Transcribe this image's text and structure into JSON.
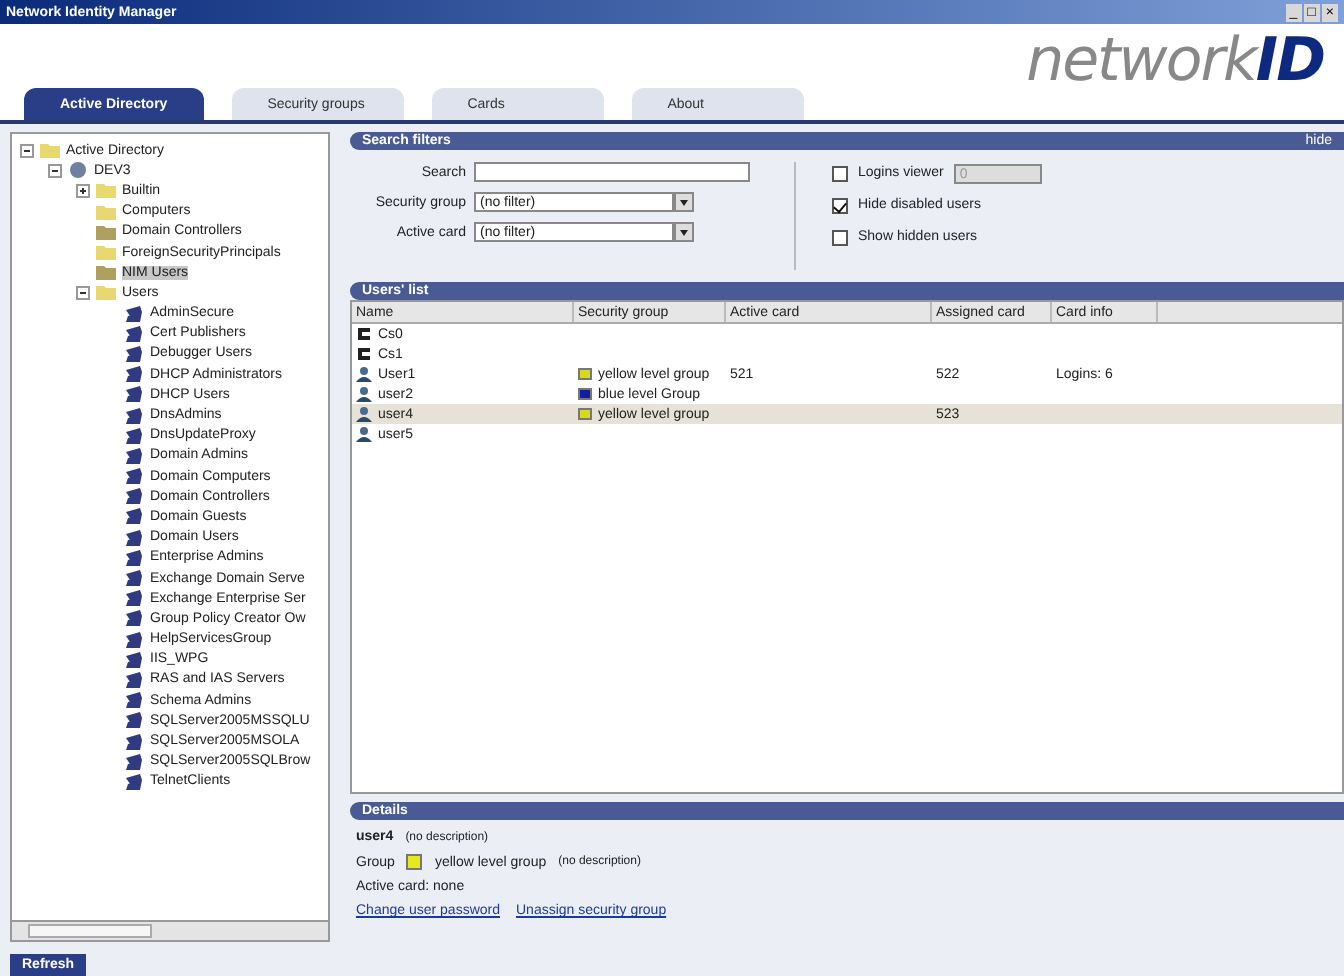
{
  "window": {
    "title": "Network Identity Manager",
    "controls": [
      "_",
      "□",
      "×"
    ]
  },
  "tabs": [
    {
      "label": "Active Directory",
      "selected": true
    },
    {
      "label": "Security groups",
      "selected": false
    },
    {
      "label": "Cards",
      "selected": false
    },
    {
      "label": "About",
      "selected": false
    }
  ],
  "logo": {
    "light": "network",
    "bold": "ID"
  },
  "tree": [
    {
      "label": "Active Directory",
      "kind": "folder",
      "expanded": true,
      "children": [
        {
          "label": "DEV3",
          "kind": "domain",
          "expanded": true,
          "children": [
            {
              "label": "Builtin",
              "kind": "folder",
              "expanded": false
            },
            {
              "label": "Computers",
              "kind": "folder"
            },
            {
              "label": "Domain Controllers",
              "kind": "ou"
            },
            {
              "label": "ForeignSecurityPrincipals",
              "kind": "folder"
            },
            {
              "label": "NIM Users",
              "kind": "ou",
              "selected": true
            },
            {
              "label": "Users",
              "kind": "folder",
              "expanded": true,
              "children": [
                {
                  "label": "AdminSecure",
                  "kind": "group"
                },
                {
                  "label": "Cert Publishers",
                  "kind": "group"
                },
                {
                  "label": "Debugger Users",
                  "kind": "group"
                },
                {
                  "label": "DHCP Administrators",
                  "kind": "group"
                },
                {
                  "label": "DHCP Users",
                  "kind": "group"
                },
                {
                  "label": "DnsAdmins",
                  "kind": "group"
                },
                {
                  "label": "DnsUpdateProxy",
                  "kind": "group"
                },
                {
                  "label": "Domain Admins",
                  "kind": "group"
                },
                {
                  "label": "Domain Computers",
                  "kind": "group"
                },
                {
                  "label": "Domain Controllers",
                  "kind": "group"
                },
                {
                  "label": "Domain Guests",
                  "kind": "group"
                },
                {
                  "label": "Domain Users",
                  "kind": "group"
                },
                {
                  "label": "Enterprise Admins",
                  "kind": "group"
                },
                {
                  "label": "Exchange Domain Serve",
                  "kind": "group"
                },
                {
                  "label": "Exchange Enterprise Ser",
                  "kind": "group"
                },
                {
                  "label": "Group Policy Creator Ow",
                  "kind": "group"
                },
                {
                  "label": "HelpServicesGroup",
                  "kind": "group"
                },
                {
                  "label": "IIS_WPG",
                  "kind": "group"
                },
                {
                  "label": "RAS and IAS Servers",
                  "kind": "group"
                },
                {
                  "label": "Schema Admins",
                  "kind": "group"
                },
                {
                  "label": "SQLServer2005MSSQLU",
                  "kind": "group"
                },
                {
                  "label": "SQLServer2005MSOLA",
                  "kind": "group"
                },
                {
                  "label": "SQLServer2005SQLBrow",
                  "kind": "group"
                },
                {
                  "label": "TelnetClients",
                  "kind": "group"
                }
              ]
            }
          ]
        }
      ]
    }
  ],
  "refresh_button": "Refresh",
  "search_filters": {
    "title": "Search filters",
    "hide_link": "hide",
    "search": {
      "label": "Search"
    },
    "security_group": {
      "label": "Security group",
      "value": "(no filter)"
    },
    "active_card": {
      "label": "Active card",
      "value": "(no filter)"
    },
    "options": [
      {
        "label": "Logins viewer",
        "checked": false,
        "spinner": "0"
      },
      {
        "label": "Hide disabled users",
        "checked": true
      },
      {
        "label": "Show hidden users",
        "checked": false
      }
    ]
  },
  "users_list": {
    "title": "Users' list",
    "columns": [
      "Name",
      "Security group",
      "Active card",
      "Assigned card",
      "Card info"
    ],
    "rows": [
      {
        "kind": "computer",
        "name": "Cs0",
        "selected": false
      },
      {
        "kind": "computer",
        "name": "Cs1",
        "selected": false
      },
      {
        "kind": "user",
        "name": "User1",
        "group": "yellow level group",
        "color": "#d8d820",
        "active": "521",
        "assigned": "522",
        "info": "Logins: 6",
        "selected": false
      },
      {
        "kind": "user",
        "name": "user2",
        "group": "blue level Group",
        "color": "#1020a0",
        "selected": false
      },
      {
        "kind": "user",
        "name": "user4",
        "group": "yellow level group",
        "color": "#d8d820",
        "assigned": "523",
        "selected": true
      },
      {
        "kind": "user",
        "name": "user5",
        "selected": false
      }
    ]
  },
  "details": {
    "title": "Details",
    "user": "user4",
    "user_description": "(no description)",
    "group_label": "Group",
    "color": "#e8e820",
    "group": "yellow level group",
    "group_description": "(no description)",
    "active_card": "Active card: none",
    "links": [
      "Change user password",
      "Unassign security group"
    ]
  }
}
